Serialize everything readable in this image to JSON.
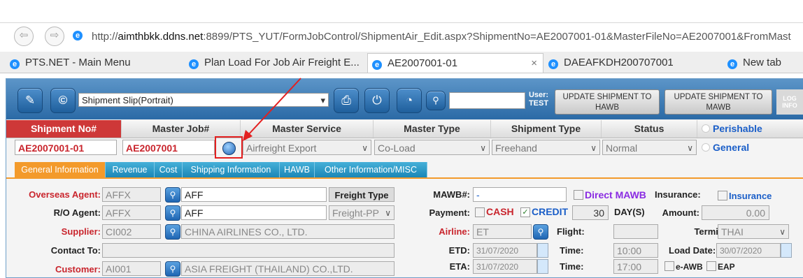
{
  "browser": {
    "url_prefix": "http://",
    "url_host": "aimthbkk.ddns.net",
    "url_rest": ":8899/PTS_YUT/FormJobControl/ShipmentAir_Edit.aspx?ShipmentNo=AE2007001-01&MasterFileNo=AE2007001&FromMast",
    "tabs": [
      {
        "label": "PTS.NET - Main Menu"
      },
      {
        "label": "Plan Load For Job Air Freight E..."
      },
      {
        "label": "AE2007001-01"
      },
      {
        "label": "DAEAFKDH200707001"
      },
      {
        "label": "New tab"
      }
    ],
    "tab_close": "×"
  },
  "toolbar": {
    "report_select": "Shipment Slip(Portrait)",
    "user_label": "User:",
    "user_name": "TEST",
    "update_hawb": "UPDATE SHIPMENT TO HAWB",
    "update_mawb": "UPDATE SHIPMENT TO MAWB",
    "log_info": "LOG INFO"
  },
  "header": {
    "shipment_no": "Shipment No#",
    "master_job": "Master Job#",
    "master_service": "Master Service",
    "master_type": "Master Type",
    "shipment_type": "Shipment Type",
    "status": "Status",
    "perishable": "Perishable",
    "general": "General"
  },
  "values": {
    "shipment_no": "AE2007001-01",
    "master_job": "AE2007001",
    "master_service": "Airfreight Export",
    "master_type": "Co-Load",
    "shipment_type": "Freehand",
    "status": "Normal"
  },
  "form_tabs": [
    "General Information",
    "Revenue",
    "Cost",
    "Shipping Information",
    "HAWB",
    "Other Information/MISC"
  ],
  "form": {
    "overseas_agent_label": "Overseas Agent:",
    "overseas_agent_code": "AFFX",
    "overseas_agent_name": "AFF",
    "freight_type_label": "Freight Type",
    "ro_agent_label": "R/O Agent:",
    "ro_agent_code": "AFFX",
    "ro_agent_name": "AFF",
    "freight_type_value": "Freight-PP",
    "supplier_label": "Supplier:",
    "supplier_code": "CI002",
    "supplier_name": "CHINA AIRLINES CO., LTD.",
    "contact_label": "Contact To:",
    "customer_label": "Customer:",
    "customer_code": "AI001",
    "customer_name": "ASIA  FREIGHT (THAILAND) CO.,LTD.",
    "mawb_label": "MAWB#:",
    "mawb_value": "-",
    "direct_mawb": "Direct MAWB",
    "insurance_label": "Insurance:",
    "insurance_check": "Insurance",
    "payment_label": "Payment:",
    "cash": "CASH",
    "credit": "CREDIT",
    "credit_days": "30",
    "days_label": "DAY(S)",
    "amount_label": "Amount:",
    "amount_value": "0.00",
    "airline_label": "Airline:",
    "airline_value": "ET",
    "flight_label": "Flight:",
    "terminal_label": "Terminal:",
    "terminal_value": "THAI",
    "etd_label": "ETD:",
    "etd_value": "31/07/2020",
    "etd_time_label": "Time:",
    "etd_time": "10:00",
    "load_date_label": "Load Date:",
    "load_date_value": "30/07/2020",
    "eta_label": "ETA:",
    "eta_value": "31/07/2020",
    "eta_time_label": "Time:",
    "eta_time": "17:00",
    "eawb": "e-AWB",
    "eap": "EAP"
  },
  "colors": {
    "accent": "#2b6aa6",
    "red": "#ce3838",
    "tab_active": "#f39a2b",
    "tab": "#1a86b6"
  }
}
